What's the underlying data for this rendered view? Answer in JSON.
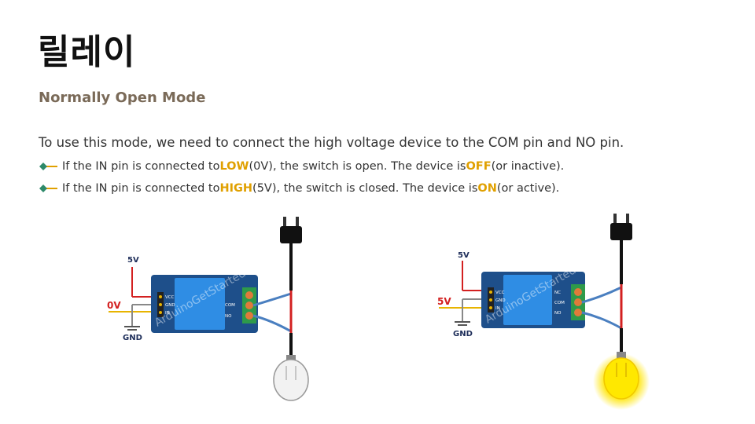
{
  "page": {
    "title": "릴레이",
    "subtitle": "Normally Open Mode",
    "intro": "To use this mode, we need to connect the high voltage device to the COM pin and NO pin."
  },
  "bullets": [
    {
      "pre": "If the IN pin is connected to ",
      "level": "LOW",
      "mid": " (0V), the switch is open. The device is ",
      "state": "OFF",
      "post": " (or inactive)."
    },
    {
      "pre": "If the IN pin is connected to ",
      "level": "HIGH",
      "mid": " (5V), the switch is closed. The device is ",
      "state": "ON",
      "post": " (or active)."
    }
  ],
  "diagrams": [
    {
      "supply_label": "5V",
      "input_label": "0V",
      "ground_label": "GND",
      "input_pins": [
        "VCC",
        "GND",
        "IN"
      ],
      "output_pins": [
        "COM",
        "NO"
      ],
      "watermark": "ArduinoGetStarted.com",
      "bulb_on": false
    },
    {
      "supply_label": "5V",
      "input_label": "5V",
      "ground_label": "GND",
      "input_pins": [
        "VCC",
        "GND",
        "IN"
      ],
      "output_pins": [
        "NC",
        "COM",
        "NO"
      ],
      "watermark": "ArduinoGetStarted.com",
      "bulb_on": true
    }
  ],
  "colors": {
    "highlight": "#e0a000",
    "subtitle": "#7a6a58",
    "wire_blue": "#4a7fc0",
    "wire_red": "#d32020",
    "wire_yellow": "#e8b400",
    "board": "#1e4f8a",
    "relay": "#2f8de4",
    "terminal": "#2e9a4a"
  }
}
